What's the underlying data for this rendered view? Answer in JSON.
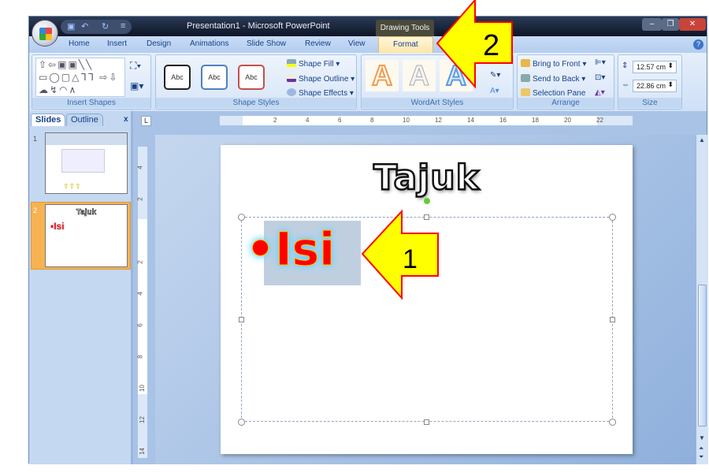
{
  "window": {
    "title": "Presentation1 - Microsoft PowerPoint",
    "contextual_tab": "Drawing Tools",
    "controls": [
      "minimize",
      "restore",
      "close"
    ]
  },
  "quick_access": {
    "icons": [
      "save-icon",
      "undo-icon",
      "redo-icon",
      "customize-icon"
    ]
  },
  "tabs": [
    {
      "label": "Home"
    },
    {
      "label": "Insert"
    },
    {
      "label": "Design"
    },
    {
      "label": "Animations"
    },
    {
      "label": "Slide Show"
    },
    {
      "label": "Review"
    },
    {
      "label": "View"
    },
    {
      "label": "Format",
      "active": true
    }
  ],
  "ribbon": {
    "insert_shapes": {
      "label": "Insert Shapes",
      "shape_glyphs": "⇧⇦▣▣╲╲ ▭◯▢△ᒣᒣ ⇨⇩☁↯◠∧"
    },
    "shape_styles": {
      "label": "Shape Styles",
      "presets": [
        {
          "label": "Abc",
          "color": "#222222"
        },
        {
          "label": "Abc",
          "color": "#4f81bd"
        },
        {
          "label": "Abc",
          "color": "#c0504d"
        }
      ],
      "shape_fill": "Shape Fill",
      "shape_outline": "Shape Outline",
      "shape_effects": "Shape Effects"
    },
    "wordart_styles": {
      "label": "WordArt Styles",
      "presets": [
        "A",
        "A",
        "A"
      ]
    },
    "arrange": {
      "label": "Arrange",
      "bring_to_front": "Bring to Front",
      "send_to_back": "Send to Back",
      "selection_pane": "Selection Pane"
    },
    "size": {
      "label": "Size",
      "height": "12.57 cm",
      "width": "22.86 cm"
    }
  },
  "slides_panel": {
    "tabs": [
      "Slides",
      "Outline"
    ],
    "close": "x",
    "slides": [
      {
        "number": "1"
      },
      {
        "number": "2",
        "title": "Tajuk",
        "body": "•Isi",
        "selected": true
      }
    ]
  },
  "rulers": {
    "horizontal": [
      "2",
      "4",
      "6",
      "8",
      "10",
      "12",
      "14",
      "16",
      "18",
      "20",
      "22"
    ],
    "vertical": [
      "4",
      "2",
      "2",
      "4",
      "6",
      "8",
      "10",
      "12",
      "14"
    ]
  },
  "slide": {
    "title": "Tajuk",
    "body": "•Isi"
  },
  "callouts": [
    {
      "label": "1",
      "target": "body text"
    },
    {
      "label": "2",
      "target": "Format tab"
    }
  ],
  "colors": {
    "accent_arrow": "#ffff00",
    "arrow_border": "#ff0000",
    "body_text": "#ff0000",
    "active_tab": "#fde6a8"
  }
}
